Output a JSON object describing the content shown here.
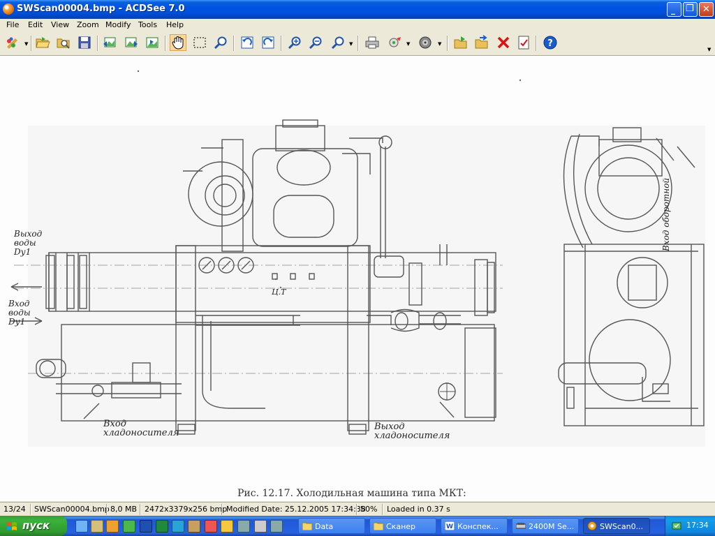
{
  "window": {
    "title": "SWScan00004.bmp - ACDSee 7.0",
    "controls": {
      "minimize": "_",
      "maximize": "❐",
      "close": "✕"
    }
  },
  "menu": [
    "File",
    "Edit",
    "View",
    "Zoom",
    "Modify",
    "Tools",
    "Help"
  ],
  "toolbar": {
    "buttons": [
      "acquire-icon",
      "open-folder-icon",
      "browse-icon",
      "save-icon",
      "previous-image-icon",
      "next-image-icon",
      "slideshow-icon",
      "hand-tool-icon",
      "select-tool-icon",
      "magnify-icon",
      "rotate-left-icon",
      "rotate-right-icon",
      "zoom-in-icon",
      "zoom-out-icon",
      "zoom-menu-icon",
      "print-icon",
      "export-icon",
      "sound-icon",
      "copy-to-icon",
      "move-to-icon",
      "delete-icon",
      "properties-icon",
      "help-icon"
    ]
  },
  "image": {
    "labels": {
      "water_out": "Выход\nводы\nDу1",
      "water_in": "Вход\nводы\nDу1",
      "ct": "Ц.Т",
      "coolant_in": "Вход\nхладоносителя",
      "coolant_out": "Выход\nхладоносителя",
      "circulating_in": "Вход оборотной"
    },
    "caption": "Рис. 12.17. Холодильная машина типа МКТ:"
  },
  "statusbar": {
    "index": "13/24",
    "filename": "SWScan00004.bmp",
    "filesize": "8,0 MB",
    "dimensions": "2472x3379x256 bmp",
    "modified": "Modified Date: 25.12.2005 17:34:38",
    "zoom": "50%",
    "load_time": "Loaded in 0.37 s"
  },
  "taskbar": {
    "start_label": "пуск",
    "tasks": [
      "Data",
      "Сканер",
      "Конспек...",
      "2400M Se...",
      "SWScan0..."
    ],
    "clock": "17:34"
  },
  "colors": {
    "title_blue": "#0054e3",
    "start_green": "#3bb23b",
    "drawing_ink": "#555555"
  }
}
